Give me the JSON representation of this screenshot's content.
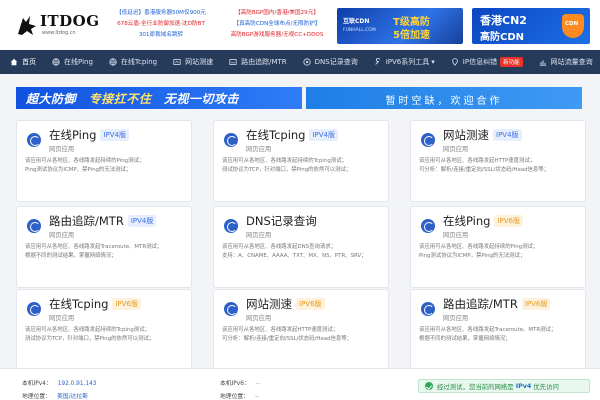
{
  "logo": {
    "text": "ITDOG",
    "sub": "www.itdog.cn"
  },
  "ads": {
    "col1": [
      "【低延迟】香港服务器50M仅900元",
      "678云盾-全行业防御加速-沈D防BT",
      "301原裁域名跳转"
    ],
    "col2": [
      "【高防BGP国内/香港/美国29元】",
      "【真高防CDN全球布点/无限防护】",
      "高防BGP游戏服务器/无视CC+DDOS"
    ]
  },
  "banner_cdn": {
    "brand": "互联CDN",
    "site": "FUNHALL.COM",
    "line1": "T级高防",
    "line2": "5倍加速"
  },
  "banner_cn2": {
    "line1": "香港CN2",
    "line2": "高防CDN",
    "shield": "CDN"
  },
  "nav": {
    "items": [
      {
        "label": "首页",
        "icon": "home-icon",
        "active": true
      },
      {
        "label": "在线Ping",
        "icon": "globe-icon"
      },
      {
        "label": "在线Tcping",
        "icon": "globe-icon"
      },
      {
        "label": "网站测速",
        "icon": "speed-icon"
      },
      {
        "label": "路由追踪/MTR",
        "icon": "route-icon"
      },
      {
        "label": "DNS记录查询",
        "icon": "dns-icon"
      },
      {
        "label": "IPV6系列工具",
        "icon": "tool-icon",
        "caret": "▾"
      },
      {
        "label": "IP信息纠错",
        "icon": "location-icon",
        "badge": "新功能"
      }
    ],
    "right": {
      "label": "网站流量查询",
      "icon": "chart-icon"
    }
  },
  "promo1": {
    "a": "超大防御",
    "b": "专接扛不住",
    "c": "无视一切攻击"
  },
  "promo2": {
    "text": "暂时空缺，欢迎合作"
  },
  "cards": [
    {
      "title": "在线Ping",
      "tag": "IPV4版",
      "sub": "网页应用",
      "d1": "该应用可从各地区、各线路发起持续的Ping测试；",
      "d2": "Ping测试协议为ICMP，禁Ping的无法测试；"
    },
    {
      "title": "在线Tcping",
      "tag": "IPV4版",
      "sub": "网页应用",
      "d1": "该应用可从各地区、各线路发起持续的Tcping测试；",
      "d2": "测试协议为TCP，针对端口，禁Ping的依然可以测试；"
    },
    {
      "title": "网站测速",
      "tag": "IPV4版",
      "sub": "网页应用",
      "d1": "该应用可从各地区、各线路发起HTTP速度测试；",
      "d2": "可分析：解析/连接/重定向/SSL/状态码/Head信息等；"
    },
    {
      "title": "路由追踪/MTR",
      "tag": "IPV4版",
      "sub": "网页应用",
      "d1": "该应用可从各地区、各线路发起Traceroute、MTR测试；",
      "d2": "根据不同的测试结果，掌握网络情况；"
    },
    {
      "title": "DNS记录查询",
      "tag": "",
      "sub": "网页应用",
      "d1": "该应用可从各地区、各线路发起DNS查询请求；",
      "d2": "支持：A、CNAME、AAAA、TXT、MX、NS、PTR、SRV；"
    },
    {
      "title": "在线Ping",
      "tag": "IPV6版",
      "sub": "网页应用",
      "d1": "该应用可从各地区、各线路发起持续的Ping测试；",
      "d2": "Ping测试协议为ICMP，禁Ping的无法测试；"
    },
    {
      "title": "在线Tcping",
      "tag": "IPV6版",
      "sub": "网页应用",
      "d1": "该应用可从各地区、各线路发起持续的Tcping测试；",
      "d2": "测试协议为TCP，针对端口，禁Ping的依然可以测试；"
    },
    {
      "title": "网站测速",
      "tag": "IPV6版",
      "sub": "网页应用",
      "d1": "该应用可从各地区、各线路发起HTTP速度测试；",
      "d2": "可分析：解析/连接/重定向/SSL/状态码/Head信息等；"
    },
    {
      "title": "路由追踪/MTR",
      "tag": "IPV6版",
      "sub": "网页应用",
      "d1": "该应用可从各地区、各线路发起Traceroute、MTR测试；",
      "d2": "根据不同的测试结果，掌握网络情况；"
    }
  ],
  "info": {
    "ipv4_label": "本机IPv4：",
    "ipv4_value": "192.0.91.143",
    "loc_label": "地理位置：",
    "loc_value": "美国/达拉斯",
    "ipv6_label": "本机IPv6：",
    "ipv6_value": "--",
    "loc6_label": "地理位置：",
    "loc6_value": "--",
    "ok_pre": "经过测试，您当前的网络是",
    "ok_mid": "IPv4",
    "ok_post": "优先访问"
  }
}
